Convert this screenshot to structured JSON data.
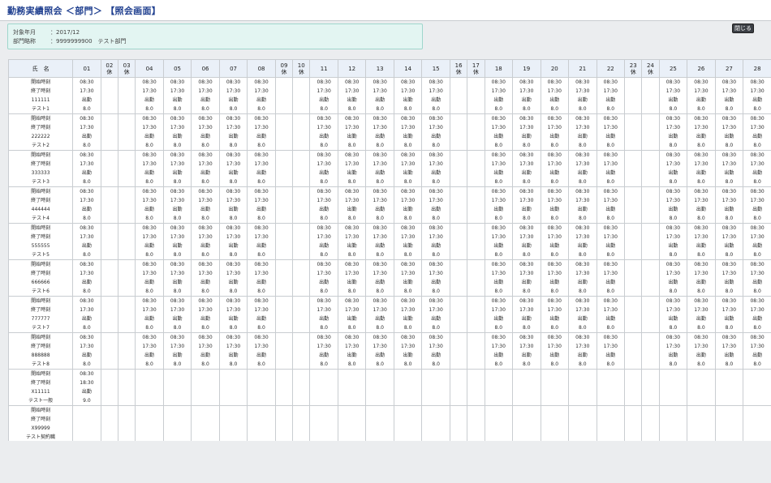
{
  "page": {
    "title": "勤務実績照会 ＜部門＞ 【照会画面】",
    "close_label": "閉じる"
  },
  "info": {
    "month_label": "対象年月",
    "month_value": "：2017/12",
    "dept_label": "部門略称",
    "dept_value": "：9999999900　テスト部門"
  },
  "grid": {
    "name_header": "氏　名",
    "holiday_label": "休",
    "days": [
      {
        "day": "01",
        "holiday": false
      },
      {
        "day": "02",
        "holiday": true
      },
      {
        "day": "03",
        "holiday": true
      },
      {
        "day": "04",
        "holiday": false
      },
      {
        "day": "05",
        "holiday": false
      },
      {
        "day": "06",
        "holiday": false
      },
      {
        "day": "07",
        "holiday": false
      },
      {
        "day": "08",
        "holiday": false
      },
      {
        "day": "09",
        "holiday": true
      },
      {
        "day": "10",
        "holiday": true
      },
      {
        "day": "11",
        "holiday": false
      },
      {
        "day": "12",
        "holiday": false
      },
      {
        "day": "13",
        "holiday": false
      },
      {
        "day": "14",
        "holiday": false
      },
      {
        "day": "15",
        "holiday": false
      },
      {
        "day": "16",
        "holiday": true
      },
      {
        "day": "17",
        "holiday": true
      },
      {
        "day": "18",
        "holiday": false
      },
      {
        "day": "19",
        "holiday": false
      },
      {
        "day": "20",
        "holiday": false
      },
      {
        "day": "21",
        "holiday": false
      },
      {
        "day": "22",
        "holiday": false
      },
      {
        "day": "23",
        "holiday": true
      },
      {
        "day": "24",
        "holiday": true
      },
      {
        "day": "25",
        "holiday": false
      },
      {
        "day": "26",
        "holiday": false
      },
      {
        "day": "27",
        "holiday": false
      },
      {
        "day": "28",
        "holiday": false
      }
    ],
    "row_labels": [
      "開始時刻",
      "終了時刻"
    ],
    "default_entry": {
      "start": "08:30",
      "end": "17:30",
      "type": "出勤",
      "hours": "8.0"
    },
    "employees": [
      {
        "code": "111111",
        "name": "テスト1",
        "pattern": "standard"
      },
      {
        "code": "222222",
        "name": "テスト2",
        "pattern": "standard"
      },
      {
        "code": "333333",
        "name": "テスト3",
        "pattern": "standard"
      },
      {
        "code": "444444",
        "name": "テスト4",
        "pattern": "standard"
      },
      {
        "code": "555555",
        "name": "テスト5",
        "pattern": "standard"
      },
      {
        "code": "666666",
        "name": "テスト6",
        "pattern": "standard"
      },
      {
        "code": "777777",
        "name": "テスト7",
        "pattern": "standard"
      },
      {
        "code": "888888",
        "name": "テスト8",
        "pattern": "standard"
      },
      {
        "code": "X11111",
        "name": "テスト一般",
        "pattern": "first_only",
        "first_entry": {
          "start": "08:30",
          "end": "18:30",
          "type": "出勤",
          "hours": "9.0"
        }
      },
      {
        "code": "X99999",
        "name": "テスト契約職",
        "pattern": "none"
      }
    ]
  }
}
